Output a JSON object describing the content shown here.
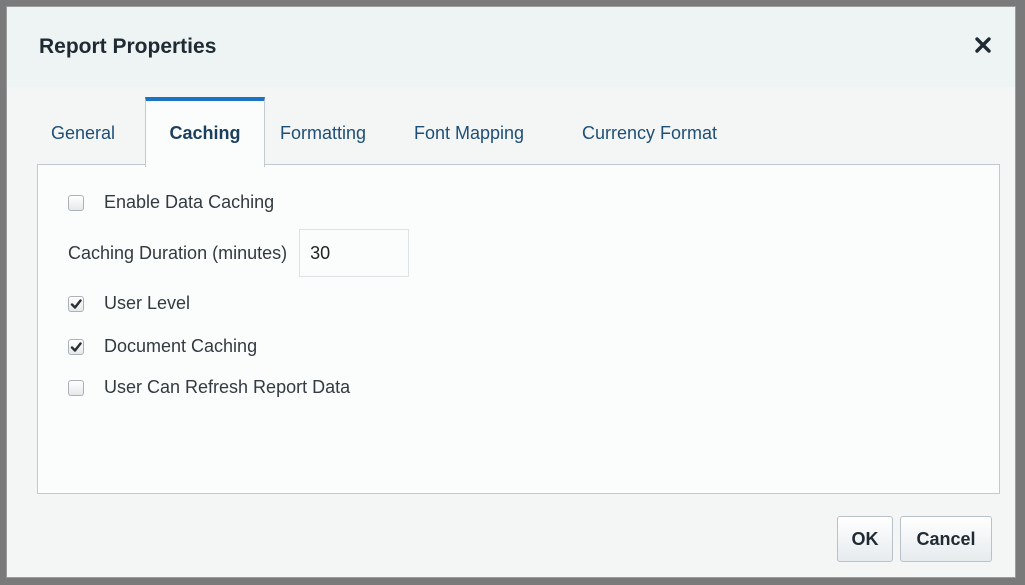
{
  "dialog": {
    "title": "Report Properties"
  },
  "tabs": [
    {
      "label": "General",
      "active": false
    },
    {
      "label": "Caching",
      "active": true
    },
    {
      "label": "Formatting",
      "active": false
    },
    {
      "label": "Font Mapping",
      "active": false
    },
    {
      "label": "Currency Format",
      "active": false
    }
  ],
  "caching": {
    "enable_data_caching": {
      "label": "Enable Data Caching",
      "checked": false
    },
    "duration": {
      "label": "Caching Duration (minutes)",
      "value": "30"
    },
    "user_level": {
      "label": "User Level",
      "checked": true
    },
    "document_caching": {
      "label": "Document Caching",
      "checked": true
    },
    "user_can_refresh": {
      "label": "User Can Refresh Report Data",
      "checked": false
    }
  },
  "footer": {
    "ok_label": "OK",
    "cancel_label": "Cancel"
  },
  "colors": {
    "accent": "#1b73c4",
    "tab_text": "#1e4f78"
  }
}
